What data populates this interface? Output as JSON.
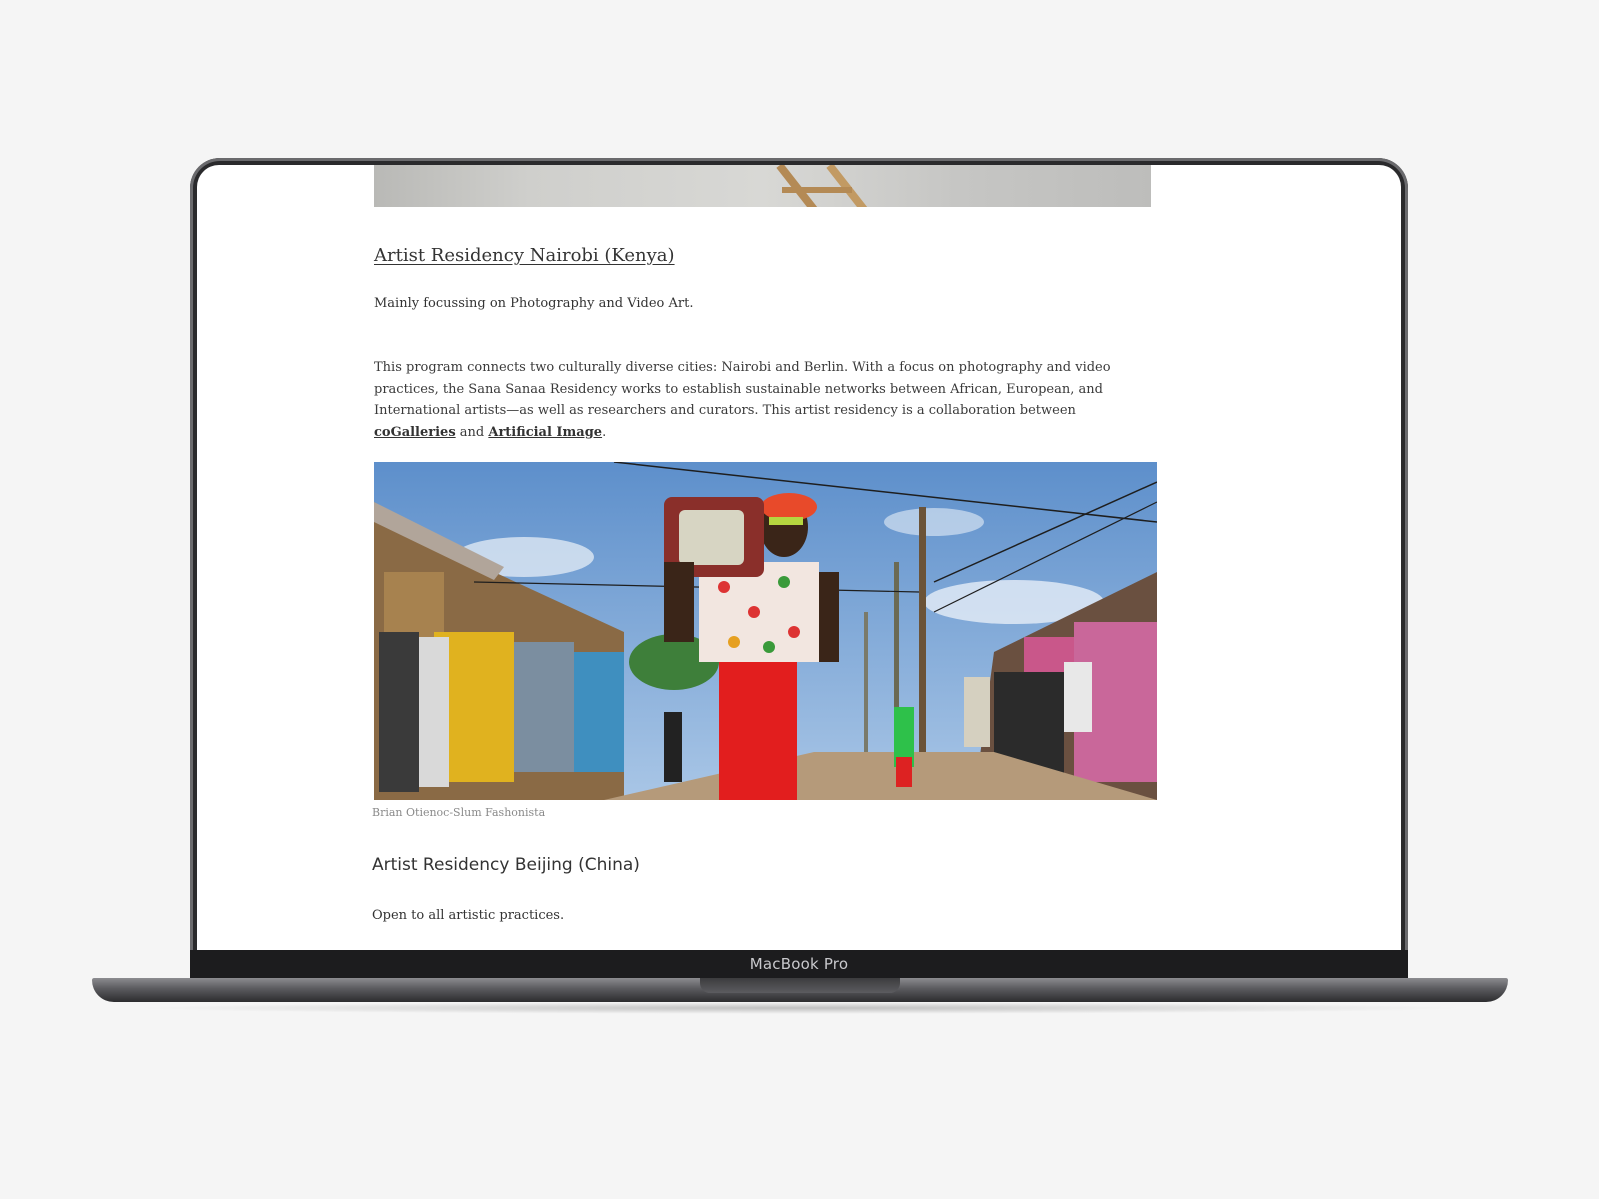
{
  "device": {
    "label": "MacBook Pro"
  },
  "sections": [
    {
      "heading": "Artist Residency Nairobi (Kenya)",
      "subtitle": "Mainly focussing on Photography and Video Art.",
      "paragraph": {
        "text_before": "This program connects two culturally diverse cities: Nairobi and Berlin. With a focus on photography and video practices, the Sana Sanaa Residency works to establish sustainable networks between African, European, and International artists—as well as researchers and curators. This artist residency is a collaboration between ",
        "link1": "coGalleries",
        "text_between": " and ",
        "link2": "Artificial Image",
        "text_after": "."
      },
      "image_caption": "Brian Otienoc-Slum Fashonista"
    },
    {
      "heading": "Artist Residency Beijing (China)",
      "subtitle": "Open to all artistic practices."
    }
  ]
}
